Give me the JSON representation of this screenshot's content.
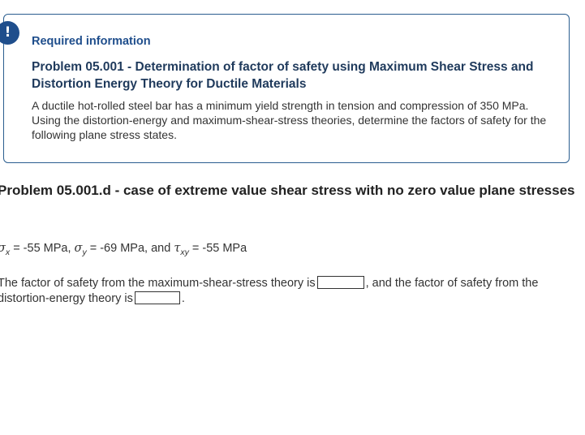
{
  "info_box": {
    "badge_glyph": "!",
    "required_label": "Required information",
    "problem_title": "Problem 05.001 - Determination of factor of safety using Maximum Shear Stress and Distortion Energy Theory for Ductile Materials",
    "problem_description": "A ductile hot-rolled steel bar has a minimum yield strength in tension and compression of 350 MPa. Using the distortion-energy and maximum-shear-stress theories, determine the factors of safety for the following plane stress states."
  },
  "part": {
    "title": "Problem 05.001.d - case of extreme value shear stress with no zero value plane stresses",
    "stresses": {
      "sigma_x_symbol": "σ",
      "sigma_x_sub": "x",
      "sigma_x_value": "= -55 MPa,",
      "sigma_y_symbol": "σ",
      "sigma_y_sub": "y",
      "sigma_y_value": "= -69 MPa, and",
      "tau_xy_symbol": "τ",
      "tau_xy_sub": "xy",
      "tau_xy_value": "= -55 MPa"
    },
    "answer": {
      "text_before_first": "The factor of safety from the maximum-shear-stress theory is",
      "text_between": ", and the factor of safety from the distortion-energy theory is",
      "text_after_second": ".",
      "max_shear_value": "",
      "distortion_energy_value": ""
    }
  }
}
